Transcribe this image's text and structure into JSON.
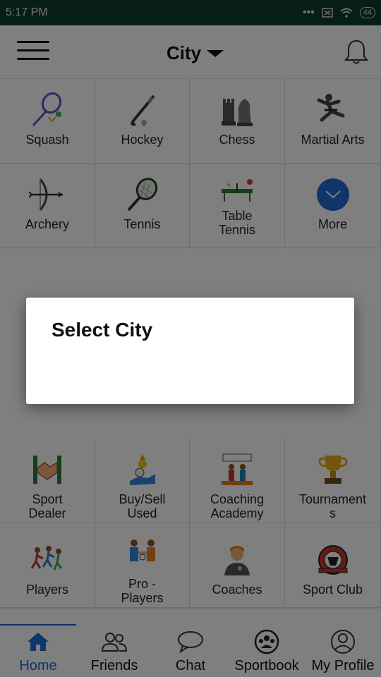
{
  "status_bar": {
    "time": "5:17 PM",
    "battery": "44"
  },
  "app_bar": {
    "city_label": "City"
  },
  "top_sports": [
    {
      "label": "Squash",
      "icon": "squash-racket-icon"
    },
    {
      "label": "Hockey",
      "icon": "hockey-stick-icon"
    },
    {
      "label": "Chess",
      "icon": "chess-pieces-icon"
    },
    {
      "label": "Martial Arts",
      "icon": "martial-arts-icon"
    },
    {
      "label": "Archery",
      "icon": "archery-bow-icon"
    },
    {
      "label": "Tennis",
      "icon": "tennis-racket-icon"
    },
    {
      "label": "Table\nTennis",
      "icon": "table-tennis-icon"
    },
    {
      "label": "More",
      "icon": "chevron-down-icon"
    }
  ],
  "services": [
    {
      "label": "Sport\nDealer",
      "icon": "handshake-icon"
    },
    {
      "label": "Buy/Sell\nUsed",
      "icon": "money-hand-icon"
    },
    {
      "label": "Coaching\nAcademy",
      "icon": "coaching-icon"
    },
    {
      "label": "Tournament\ns",
      "icon": "trophy-icon"
    },
    {
      "label": "Players",
      "icon": "runners-icon"
    },
    {
      "label": "Pro -\nPlayers",
      "icon": "pro-players-icon"
    },
    {
      "label": "Coaches",
      "icon": "coach-whistle-icon"
    },
    {
      "label": "Sport Club",
      "icon": "club-crest-icon"
    }
  ],
  "bottom_nav": [
    {
      "label": "Home",
      "icon": "home-icon",
      "active": true
    },
    {
      "label": "Friends",
      "icon": "friends-icon",
      "active": false
    },
    {
      "label": "Chat",
      "icon": "chat-bubble-icon",
      "active": false
    },
    {
      "label": "Sportbook",
      "icon": "sportbook-icon",
      "active": false
    },
    {
      "label": "My Profile",
      "icon": "profile-icon",
      "active": false
    }
  ],
  "dialog": {
    "title": "Select City"
  },
  "colors": {
    "status_bar": "#0f3d2c",
    "accent": "#1e6bd6",
    "overlay": "rgba(0,0,0,0.5)"
  }
}
